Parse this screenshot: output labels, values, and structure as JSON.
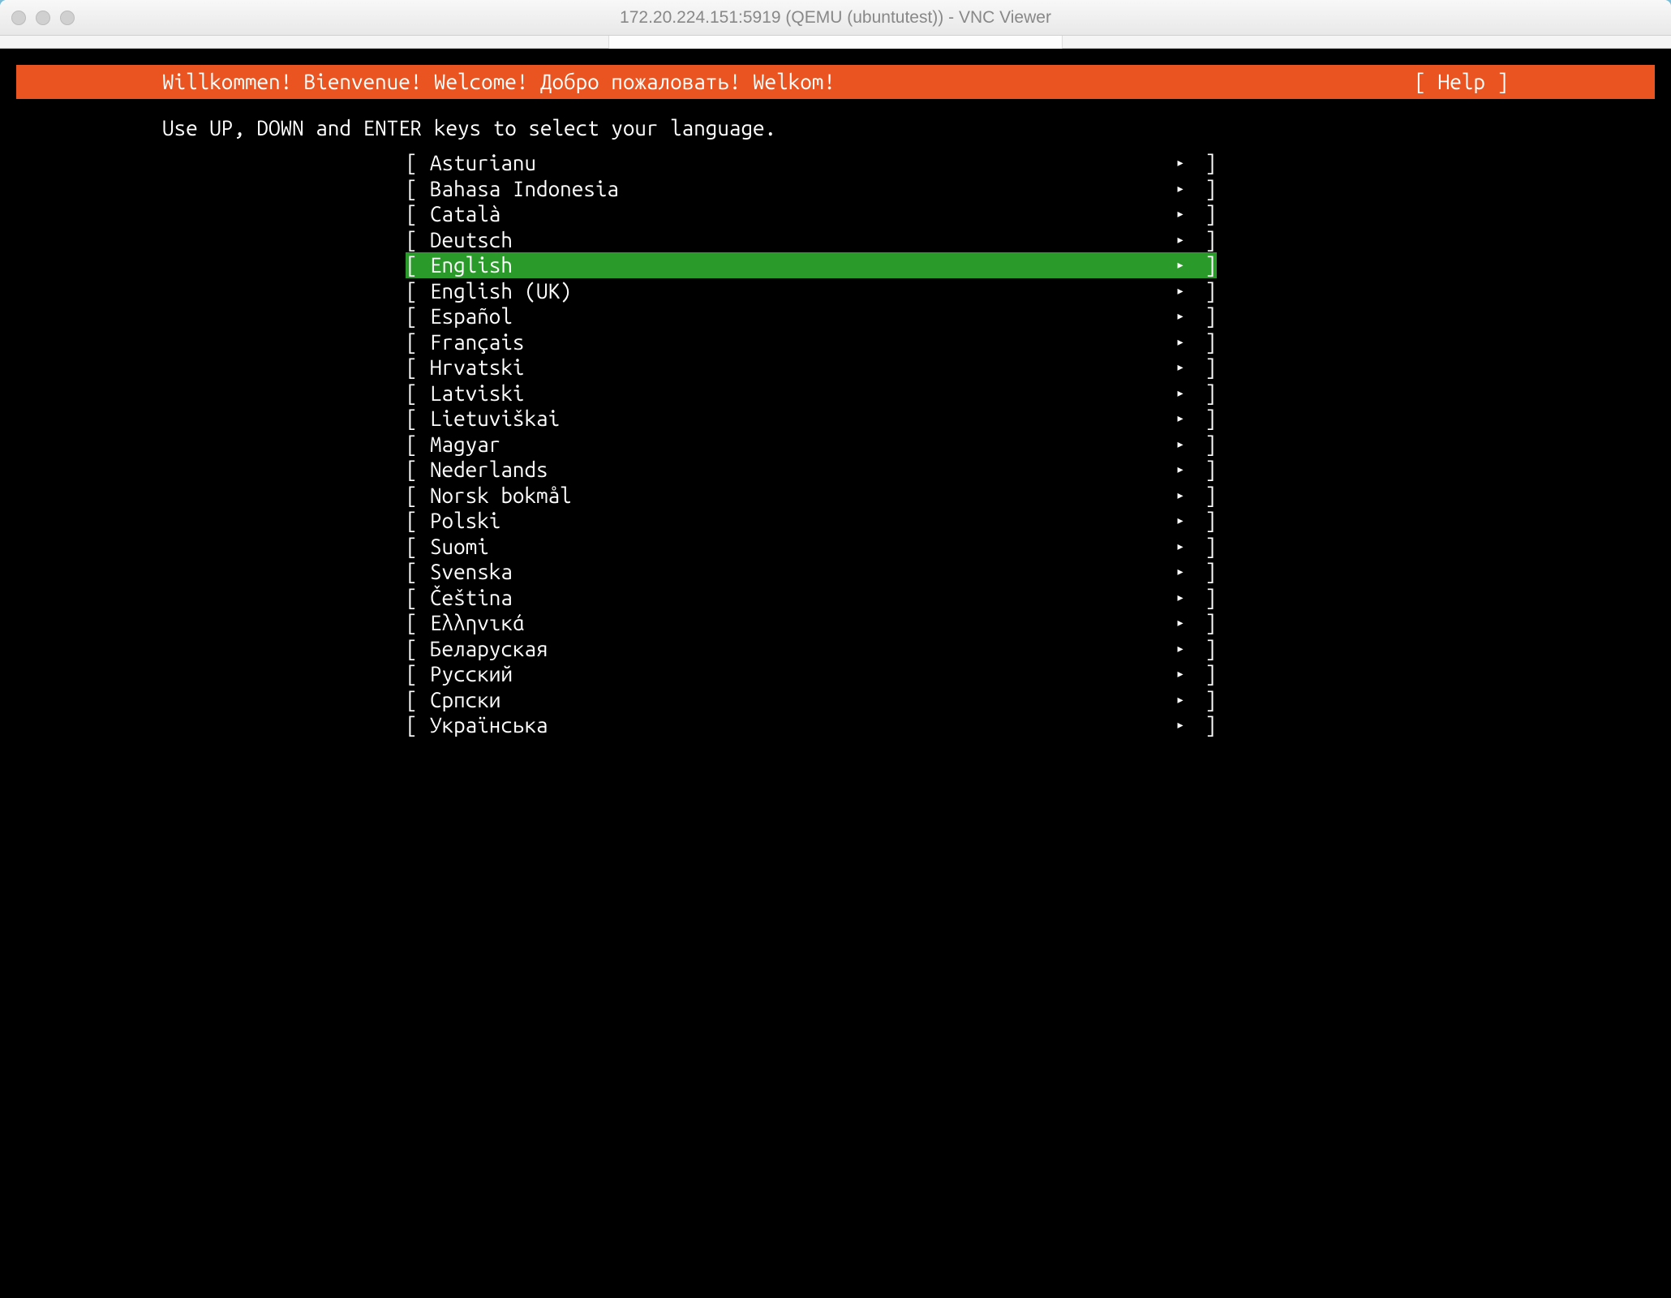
{
  "window": {
    "title": "172.20.224.151:5919 (QEMU (ubuntutest)) - VNC Viewer"
  },
  "header": {
    "welcome": "Willkommen! Bienvenue! Welcome! Добро пожаловать! Welkom!",
    "help": "[ Help ]"
  },
  "instruction": "Use UP, DOWN and ENTER keys to select your language.",
  "selected_index": 4,
  "languages": [
    "Asturianu",
    "Bahasa Indonesia",
    "Català",
    "Deutsch",
    "English",
    "English (UK)",
    "Español",
    "Français",
    "Hrvatski",
    "Latviski",
    "Lietuviškai",
    "Magyar",
    "Nederlands",
    "Norsk bokmål",
    "Polski",
    "Suomi",
    "Svenska",
    "Čeština",
    "Ελληνικά",
    "Беларуская",
    "Русский",
    "Српски",
    "Українська"
  ],
  "brackets": {
    "left": "[",
    "right": "]",
    "arrow": "▸"
  }
}
